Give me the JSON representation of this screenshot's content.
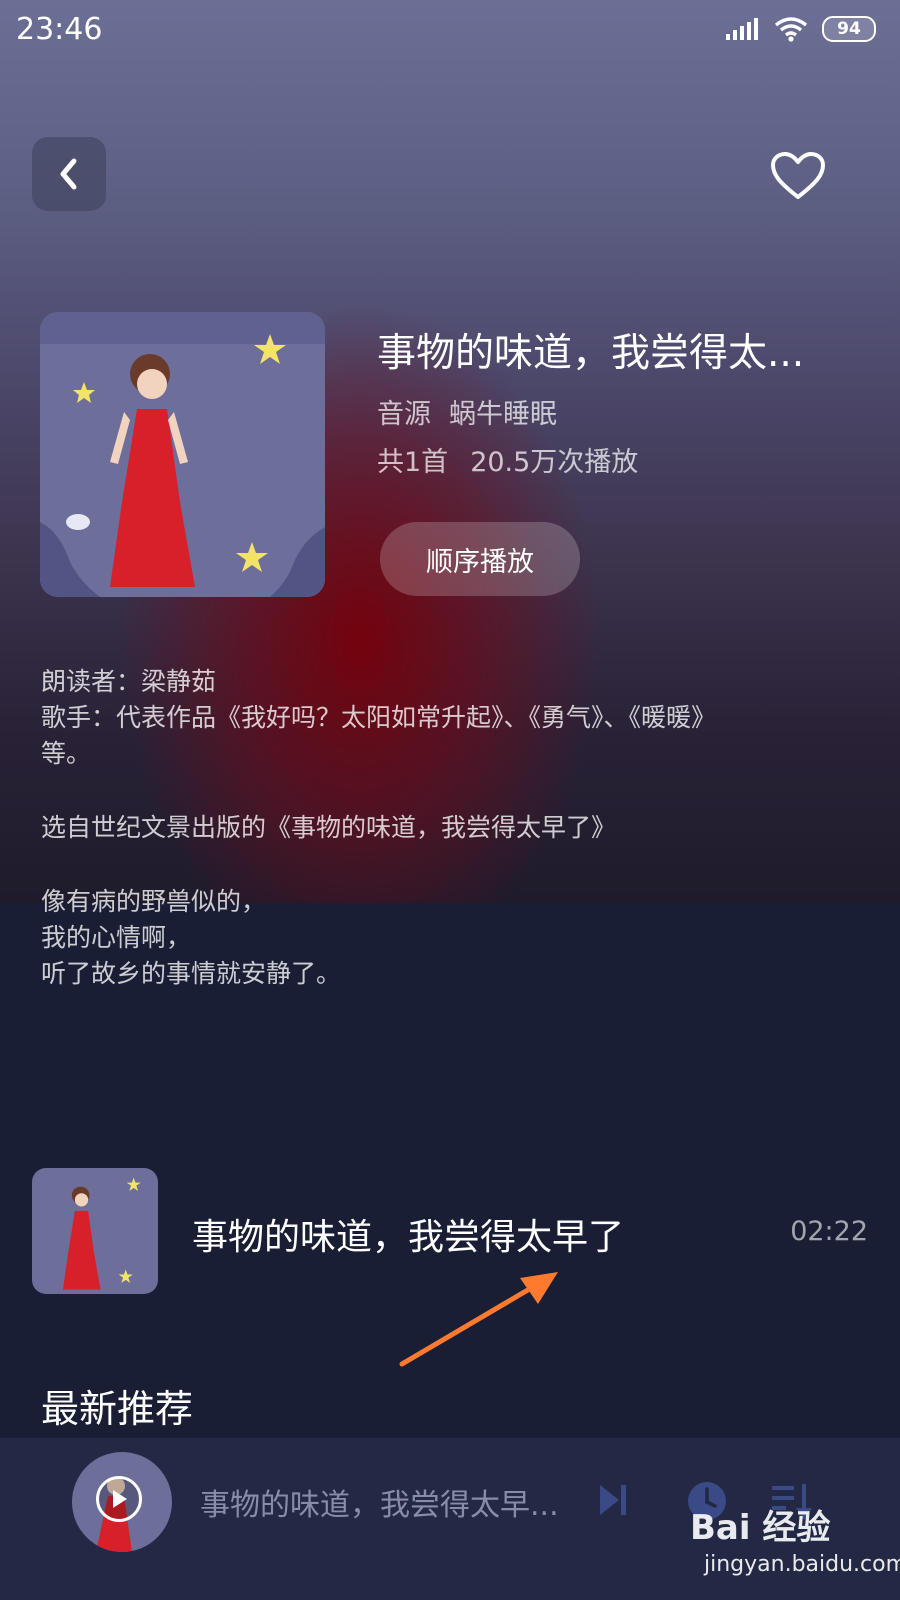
{
  "status_bar": {
    "time": "23:46",
    "battery": "94"
  },
  "header": {
    "back_icon": "chevron-left-icon",
    "favorite_icon": "heart-icon"
  },
  "album": {
    "title": "事物的味道，我尝得太...",
    "source_label": "音源",
    "source_name": "蜗牛睡眠",
    "track_count": "共1首",
    "play_count": "20.5万次播放",
    "play_order_label": "顺序播放"
  },
  "description": {
    "lines_a": [
      "朗读者：梁静茹",
      "歌手：代表作品《我好吗？太阳如常升起》、《勇气》、《暖暖》",
      "等。"
    ],
    "line_b": "选自世纪文景出版的《事物的味道，我尝得太早了》",
    "lines_c": [
      "像有病的野兽似的，",
      "我的心情啊，",
      "听了故乡的事情就安静了。"
    ]
  },
  "track": {
    "title": "事物的味道，我尝得太早了",
    "duration": "02:22"
  },
  "section": {
    "latest_heading": "最新推荐"
  },
  "mini_player": {
    "title": "事物的味道，我尝得太早..."
  },
  "watermark": {
    "logo": "Bai 经验",
    "url": "jingyan.baidu.com"
  },
  "colors": {
    "accent": "#ff7a2f",
    "background": "#191e34",
    "cover": "#6d6f9a",
    "dress": "#d8202a"
  }
}
